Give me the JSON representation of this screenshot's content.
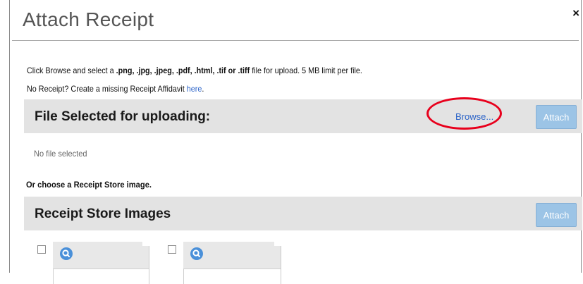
{
  "dialog": {
    "title": "Attach Receipt",
    "close_label": "×"
  },
  "intro": {
    "line1_prefix": "Click Browse and select a ",
    "line1_types": ".png, .jpg, .jpeg, .pdf, .html, .tif or .tiff",
    "line1_suffix": " file for upload.  5 MB limit per file.",
    "line2_prefix": "No Receipt? Create a missing Receipt Affidavit ",
    "line2_link": "here",
    "line2_suffix": "."
  },
  "upload_section": {
    "title": "File Selected for uploading:",
    "browse_label": "Browse...",
    "attach_label": "Attach",
    "status": "No file selected"
  },
  "store_section": {
    "choose_label": "Or choose a Receipt Store image.",
    "title": "Receipt Store Images",
    "attach_label": "Attach",
    "thumbnails": [
      {
        "icon": "search-icon"
      },
      {
        "icon": "search-icon"
      }
    ]
  },
  "colors": {
    "link": "#2b63c8",
    "section_bg": "#e3e3e3",
    "attach_button_bg": "#9cc4e6",
    "highlight_circle": "#e8001c"
  }
}
